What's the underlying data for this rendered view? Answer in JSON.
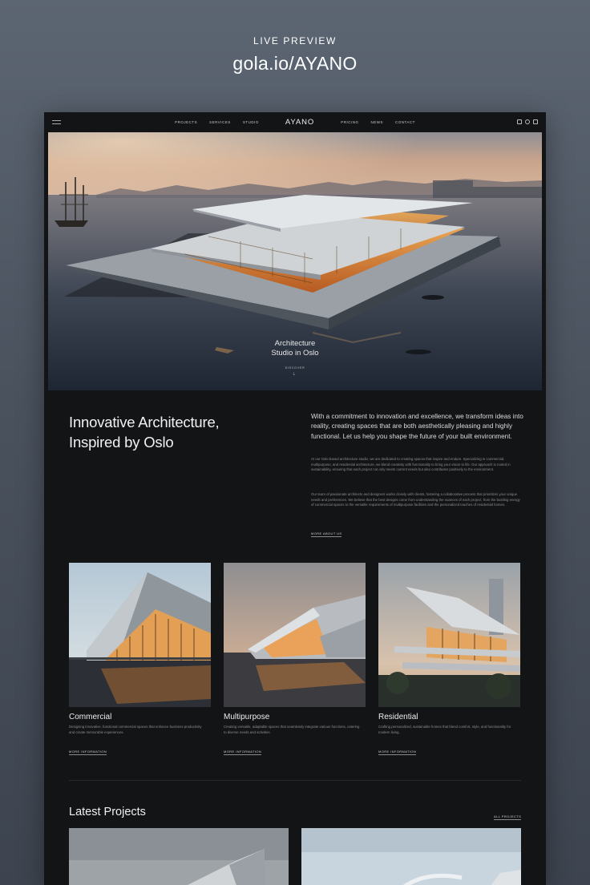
{
  "promo": {
    "kicker": "LIVE PREVIEW",
    "url": "gola.io/AYANO"
  },
  "nav": {
    "left": [
      "PROJECTS",
      "SERVICES",
      "STUDIO"
    ],
    "logo": "AYANO",
    "right": [
      "PRICING",
      "NEWS",
      "CONTACT"
    ],
    "icons": [
      "instagram-icon",
      "pinterest-icon",
      "behance-icon"
    ]
  },
  "hero": {
    "caption_line1": "Architecture",
    "caption_line2": "Studio in Oslo",
    "cta": "DISCOVER",
    "arrow": "↓"
  },
  "intro": {
    "heading_line1": "Innovative Architecture,",
    "heading_line2": "Inspired by Oslo",
    "lead": "With a commitment to innovation and excellence, we transform ideas into reality, creating spaces that are both aesthetically pleasing and highly functional. Let us help you shape the future of your built environment.",
    "p1": "At our Oslo-based architecture studio, we are dedicated to creating spaces that inspire and endure. Specializing in commercial, multipurpose, and residential architecture, we blend creativity with functionality to bring your vision to life. Our approach is rooted in sustainability, ensuring that each project not only meets current needs but also contributes positively to the environment.",
    "p2": "Our team of passionate architects and designers works closely with clients, fostering a collaborative process that prioritizes your unique needs and preferences. We believe that the best designs come from understanding the nuances of each project, from the bustling energy of commercial spaces to the versatile requirements of multipurpose facilities and the personalized touches of residential homes.",
    "link": "MORE ABOUT US"
  },
  "services": [
    {
      "title": "Commercial",
      "desc": "Designing innovative, functional commercial spaces that enhance business productivity and create memorable experiences.",
      "link": "MORE INFORMATION"
    },
    {
      "title": "Multipurpose",
      "desc": "Creating versatile, adaptable spaces that seamlessly integrate various functions, catering to diverse needs and activities.",
      "link": "MORE INFORMATION"
    },
    {
      "title": "Residential",
      "desc": "Crafting personalized, sustainable homes that blend comfort, style, and functionality for modern living.",
      "link": "MORE INFORMATION"
    }
  ],
  "latest": {
    "title": "Latest Projects",
    "link": "ALL PROJECTS"
  }
}
